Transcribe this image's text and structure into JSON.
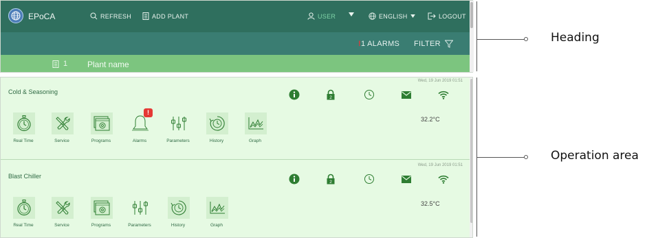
{
  "app": {
    "name": "EPoCA"
  },
  "topbar": {
    "refresh_label": "REFRESH",
    "add_plant_label": "ADD PLANT",
    "user_label": "USER",
    "language_label": "ENGLISH",
    "logout_label": "LOGOUT"
  },
  "alarmbar": {
    "alarm_count": "1",
    "alarms_label": "ALARMS",
    "filter_label": "FILTER"
  },
  "plant": {
    "number": "1",
    "name": "Plant name"
  },
  "devices": [
    {
      "name": "Cold & Seasoning",
      "timestamp": "Wed, 19 Jun 2019 01:51",
      "temperature": "32.2°C",
      "lock_number": "2",
      "tools": [
        {
          "label": "Real Time",
          "icon": "stopwatch-icon"
        },
        {
          "label": "Service",
          "icon": "wrench-screwdriver-icon"
        },
        {
          "label": "Programs",
          "icon": "programs-icon"
        },
        {
          "label": "Alarms",
          "icon": "bell-icon",
          "badge": "!"
        },
        {
          "label": "Parameters",
          "icon": "sliders-icon"
        },
        {
          "label": "History",
          "icon": "history-icon"
        },
        {
          "label": "Graph",
          "icon": "graph-icon"
        }
      ]
    },
    {
      "name": "Blast Chiller",
      "timestamp": "Wed, 19 Jun 2019 01:51",
      "temperature": "32.5°C",
      "lock_number": "2",
      "tools": [
        {
          "label": "Real Time",
          "icon": "stopwatch-icon"
        },
        {
          "label": "Service",
          "icon": "wrench-screwdriver-icon"
        },
        {
          "label": "Programs",
          "icon": "programs-icon"
        },
        {
          "label": "Parameters",
          "icon": "sliders-icon"
        },
        {
          "label": "History",
          "icon": "history-icon"
        },
        {
          "label": "Graph",
          "icon": "graph-icon"
        }
      ]
    }
  ],
  "callouts": {
    "heading": "Heading",
    "operation_area": "Operation area"
  },
  "colors": {
    "topbar": "#2f6f5e",
    "alarmbar": "#3a7d72",
    "plantbar": "#7cc57f",
    "device_bg": "#e6fae3",
    "icon_green": "#2e7d32",
    "alarm_red": "#e53935"
  }
}
